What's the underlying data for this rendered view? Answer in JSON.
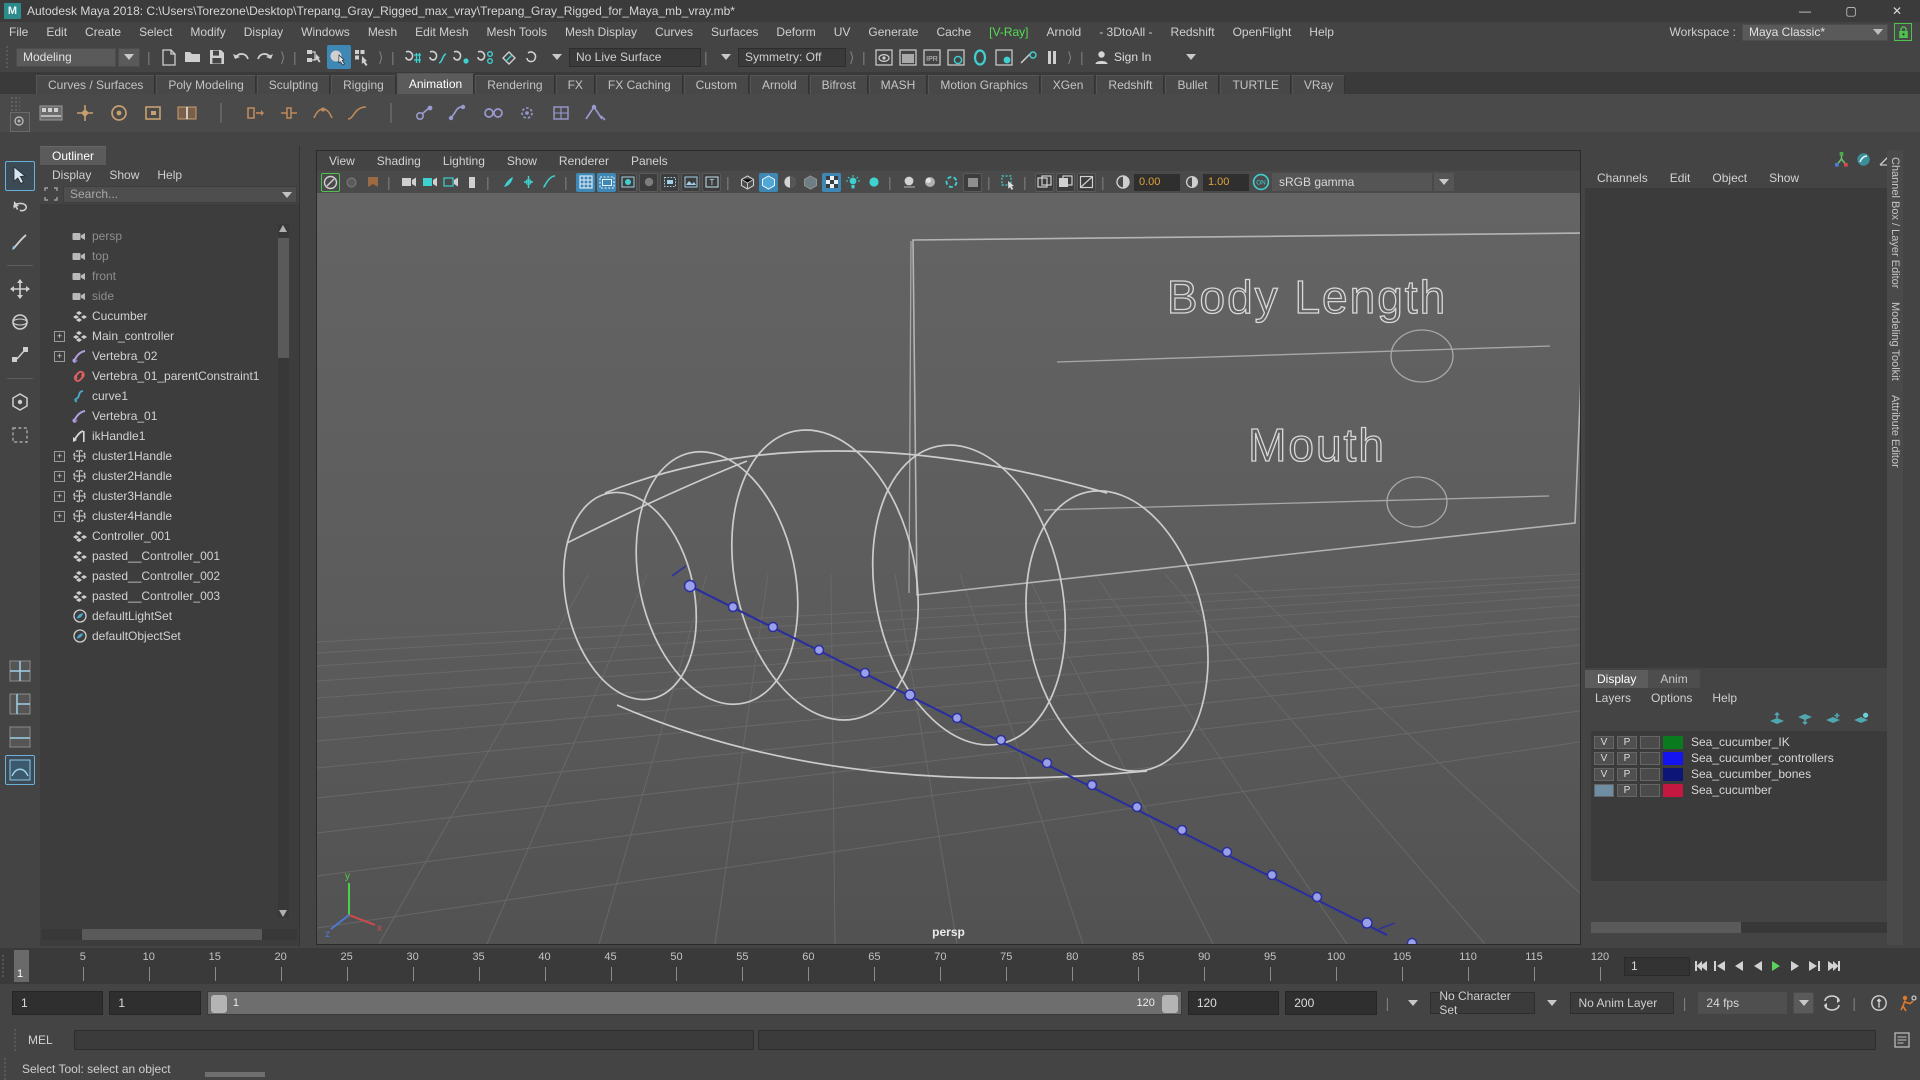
{
  "window": {
    "title": "Autodesk Maya 2018: C:\\Users\\Torezone\\Desktop\\Trepang_Gray_Rigged_max_vray\\Trepang_Gray_Rigged_for_Maya_mb_vray.mb*",
    "logo_letter": "M",
    "minimize": "—",
    "maximize": "▢",
    "close": "✕"
  },
  "menubar": {
    "items": [
      {
        "label": "File"
      },
      {
        "label": "Edit"
      },
      {
        "label": "Create"
      },
      {
        "label": "Select"
      },
      {
        "label": "Modify"
      },
      {
        "label": "Display"
      },
      {
        "label": "Windows"
      },
      {
        "label": "Mesh"
      },
      {
        "label": "Edit Mesh"
      },
      {
        "label": "Mesh Tools"
      },
      {
        "label": "Mesh Display"
      },
      {
        "label": "Curves"
      },
      {
        "label": "Surfaces"
      },
      {
        "label": "Deform"
      },
      {
        "label": "UV"
      },
      {
        "label": "Generate"
      },
      {
        "label": "Cache"
      },
      {
        "label": "[V-Ray]"
      },
      {
        "label": "Arnold"
      },
      {
        "label": "- 3DtoAll -"
      },
      {
        "label": "Redshift"
      },
      {
        "label": "OpenFlight"
      },
      {
        "label": "Help"
      }
    ],
    "workspace_label": "Workspace :",
    "workspace_value": "Maya Classic*"
  },
  "statusline": {
    "mode": "Modeling",
    "live_surface": "No Live Surface",
    "symmetry": "Symmetry: Off",
    "signin": "Sign In"
  },
  "shelf": {
    "tabs": [
      {
        "label": "Curves / Surfaces",
        "active": false
      },
      {
        "label": "Poly Modeling",
        "active": false
      },
      {
        "label": "Sculpting",
        "active": false
      },
      {
        "label": "Rigging",
        "active": false
      },
      {
        "label": "Animation",
        "active": true
      },
      {
        "label": "Rendering",
        "active": false
      },
      {
        "label": "FX",
        "active": false
      },
      {
        "label": "FX Caching",
        "active": false
      },
      {
        "label": "Custom",
        "active": false
      },
      {
        "label": "Arnold",
        "active": false
      },
      {
        "label": "Bifrost",
        "active": false
      },
      {
        "label": "MASH",
        "active": false
      },
      {
        "label": "Motion Graphics",
        "active": false
      },
      {
        "label": "XGen",
        "active": false
      },
      {
        "label": "Redshift",
        "active": false
      },
      {
        "label": "Bullet",
        "active": false
      },
      {
        "label": "TURTLE",
        "active": false
      },
      {
        "label": "VRay",
        "active": false
      }
    ]
  },
  "outliner": {
    "tab": "Outliner",
    "menus": [
      "Display",
      "Show",
      "Help"
    ],
    "search_placeholder": "Search...",
    "items": [
      {
        "label": "persp",
        "icon": "camera-icon",
        "expand": false,
        "dim": true
      },
      {
        "label": "top",
        "icon": "camera-icon",
        "expand": false,
        "dim": true
      },
      {
        "label": "front",
        "icon": "camera-icon",
        "expand": false,
        "dim": true
      },
      {
        "label": "side",
        "icon": "camera-icon",
        "expand": false,
        "dim": true
      },
      {
        "label": "Cucumber",
        "icon": "transform-icon",
        "expand": false,
        "dim": false
      },
      {
        "label": "Main_controller",
        "icon": "transform-icon",
        "expand": true,
        "dim": false
      },
      {
        "label": "Vertebra_02",
        "icon": "joint-icon",
        "expand": true,
        "dim": false
      },
      {
        "label": "Vertebra_01_parentConstraint1",
        "icon": "constraint-icon",
        "expand": false,
        "dim": false
      },
      {
        "label": "curve1",
        "icon": "curve-icon",
        "expand": false,
        "dim": false
      },
      {
        "label": "Vertebra_01",
        "icon": "joint-icon",
        "expand": false,
        "dim": false
      },
      {
        "label": "ikHandle1",
        "icon": "ikhandle-icon",
        "expand": false,
        "dim": false
      },
      {
        "label": "cluster1Handle",
        "icon": "cluster-icon",
        "expand": true,
        "dim": false
      },
      {
        "label": "cluster2Handle",
        "icon": "cluster-icon",
        "expand": true,
        "dim": false
      },
      {
        "label": "cluster3Handle",
        "icon": "cluster-icon",
        "expand": true,
        "dim": false
      },
      {
        "label": "cluster4Handle",
        "icon": "cluster-icon",
        "expand": true,
        "dim": false
      },
      {
        "label": "Controller_001",
        "icon": "transform-icon",
        "expand": false,
        "dim": false
      },
      {
        "label": "pasted__Controller_001",
        "icon": "transform-icon",
        "expand": false,
        "dim": false
      },
      {
        "label": "pasted__Controller_002",
        "icon": "transform-icon",
        "expand": false,
        "dim": false
      },
      {
        "label": "pasted__Controller_003",
        "icon": "transform-icon",
        "expand": false,
        "dim": false
      },
      {
        "label": "defaultLightSet",
        "icon": "set-icon",
        "expand": false,
        "dim": false
      },
      {
        "label": "defaultObjectSet",
        "icon": "set-icon",
        "expand": false,
        "dim": false
      }
    ]
  },
  "viewport": {
    "menus": [
      "View",
      "Shading",
      "Lighting",
      "Show",
      "Renderer",
      "Panels"
    ],
    "exposure": "0.00",
    "gamma_value": "1.00",
    "color_profile": "sRGB gamma",
    "camera_label": "persp",
    "scene_text": [
      {
        "text": "Body Length"
      },
      {
        "text": "Mouth"
      }
    ]
  },
  "channelbox": {
    "menus": [
      "Channels",
      "Edit",
      "Object",
      "Show"
    ],
    "side_tabs": [
      "Channel Box / Layer Editor",
      "Modeling Toolkit",
      "Attribute Editor"
    ]
  },
  "layereditor": {
    "tabs": [
      {
        "label": "Display",
        "active": true
      },
      {
        "label": "Anim",
        "active": false
      }
    ],
    "menus": [
      "Layers",
      "Options",
      "Help"
    ],
    "rows": [
      {
        "v": "V",
        "p": "P",
        "third": "",
        "color": "#0a7a1e",
        "name": "Sea_cucumber_IK",
        "template": false
      },
      {
        "v": "V",
        "p": "P",
        "third": "",
        "color": "#1414f0",
        "name": "Sea_cucumber_controllers",
        "template": false
      },
      {
        "v": "V",
        "p": "P",
        "third": "",
        "color": "#0d1677",
        "name": "Sea_cucumber_bones",
        "template": false
      },
      {
        "v": "",
        "p": "P",
        "third": "",
        "color": "#c41840",
        "name": "Sea_cucumber",
        "template": true
      }
    ]
  },
  "timeline": {
    "ticks": [
      5,
      10,
      15,
      20,
      25,
      30,
      35,
      40,
      45,
      50,
      55,
      60,
      65,
      70,
      75,
      80,
      85,
      90,
      95,
      100,
      105,
      110,
      115,
      120
    ],
    "start": 1,
    "end": 120,
    "current_frame": "1",
    "current_field": "1"
  },
  "rangeslider": {
    "anim_start": "1",
    "range_start": "1",
    "slider_start_label": "1",
    "slider_end_label": "120",
    "range_end": "120",
    "anim_end": "200",
    "character_set": "No Character Set",
    "anim_layer": "No Anim Layer",
    "fps": "24 fps"
  },
  "commandline": {
    "label": "MEL",
    "input_value": "",
    "output_value": ""
  },
  "helpline": {
    "text": "Select Tool: select an object"
  },
  "colors": {
    "accent_blue": "#3f88b5",
    "teal": "#2f9a9a",
    "vray_green": "#55dd55",
    "orange_value": "#e0a33a"
  }
}
